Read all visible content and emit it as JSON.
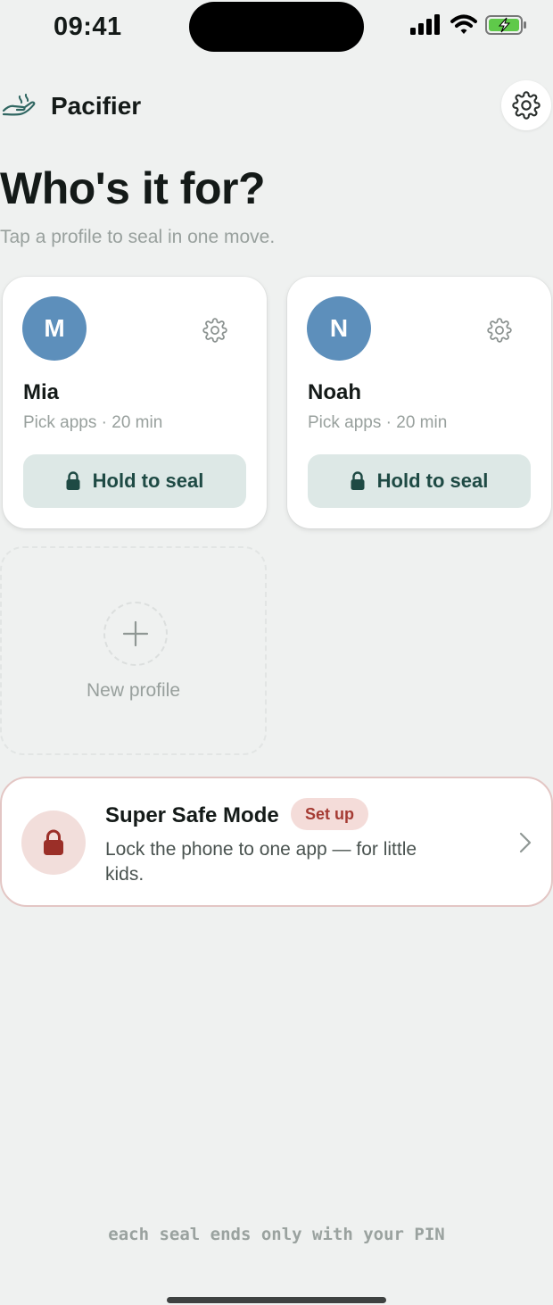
{
  "status_bar": {
    "time": "09:41"
  },
  "header": {
    "brand_name": "Pacifier",
    "brand_icon": "hand-icon",
    "settings_icon": "gear-icon"
  },
  "page": {
    "title": "Who's it for?",
    "subtitle": "Tap a profile to seal in one move."
  },
  "profiles": [
    {
      "initial": "M",
      "name": "Mia",
      "meta": "Pick apps · 20 min",
      "seal_label": "Hold to seal",
      "avatar_color": "#5d8fbb"
    },
    {
      "initial": "N",
      "name": "Noah",
      "meta": "Pick apps · 20 min",
      "seal_label": "Hold to seal",
      "avatar_color": "#5d8fbb"
    }
  ],
  "new_profile": {
    "label": "New profile"
  },
  "super_safe": {
    "title": "Super Safe Mode",
    "badge": "Set up",
    "description": "Lock the phone to one app — for little kids."
  },
  "footer": {
    "note": "each seal ends only with your PIN"
  },
  "colors": {
    "background": "#eff1f0",
    "seal_button": "#dde8e6",
    "seal_text": "#1e4a44",
    "safe_accent": "#a53b33",
    "safe_border": "#e3c6c4"
  }
}
